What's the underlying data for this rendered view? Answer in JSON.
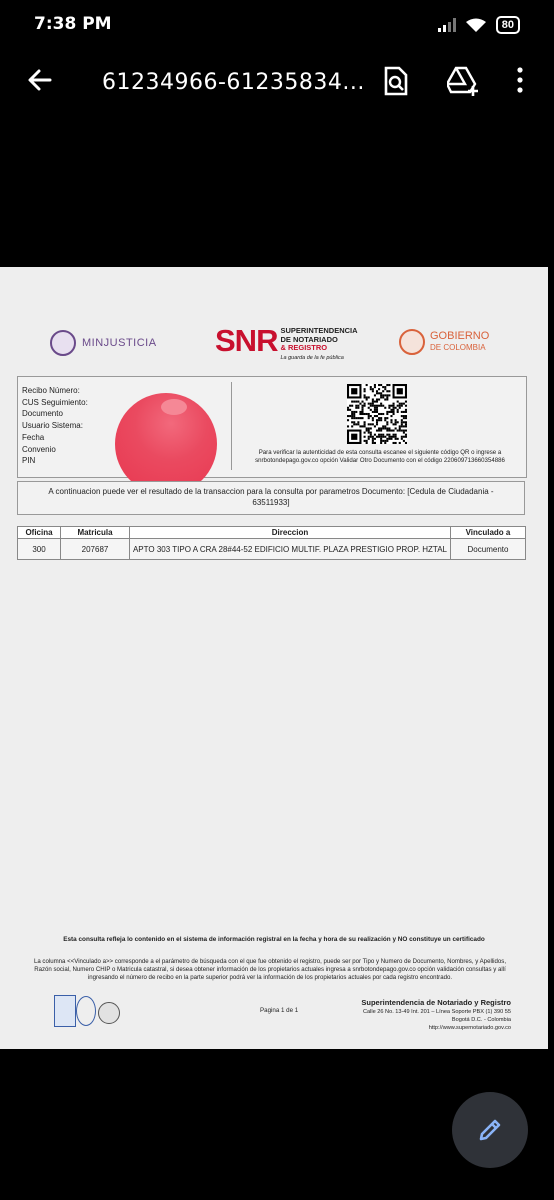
{
  "status_bar": {
    "time": "7:38 PM",
    "battery": "80"
  },
  "app_bar": {
    "title": "61234966-61235834...",
    "icons": [
      "back-arrow-icon",
      "search-document-icon",
      "drive-add-icon",
      "more-vert-icon"
    ]
  },
  "doc": {
    "logos": {
      "minjusticia": "MINJUSTICIA",
      "snr_big": "SNR",
      "snr_line1": "SUPERINTENDENCIA",
      "snr_line2": "DE NOTARIADO",
      "snr_line3": "& REGISTRO",
      "snr_tagline": "La guarda de la fe pública",
      "gobierno_line1": "GOBIERNO",
      "gobierno_line2": "DE COLOMBIA"
    },
    "info": {
      "labels": [
        "Recibo Número:",
        "CUS Seguimiento:",
        "Documento",
        "Usuario Sistema:",
        "Fecha",
        "Convenio",
        "PIN"
      ],
      "verify_text": "Para verificar la autenticidad de esta consulta escanee el siguiente código QR o ingrese a snrbotondepago.gov.co opción Validar Otro Documento con el código 220609713660354886"
    },
    "query_text": "A continuacion puede ver el resultado de la transaccion para la consulta por parametros Documento: [Cedula de Ciudadania - 63511933]",
    "table": {
      "headers": [
        "Oficina",
        "Matricula",
        "Direccion",
        "Vinculado a"
      ],
      "rows": [
        [
          "300",
          "207687",
          "APTO 303 TIPO A CRA 28#44-52 EDIFICIO MULTIF. PLAZA PRESTIGIO PROP. HZTAL",
          "Documento"
        ]
      ]
    },
    "footer": {
      "disclaimer": "Esta consulta refleja lo contenido en el sistema de información registral en la fecha y hora de su realización y NO constituye un certificado",
      "note": "La columna <<Vinculado a>> corresponde a el parámetro de búsqueda con el que fue obtenido el registro, puede ser por Tipo y Numero de Documento, Nombres, y Apellidos, Razón social, Numero CHIP o Matricula catastral, si desea obtener información de los propietarios actuales ingresa a snrbotondepago.gov.co opción validación consultas y allí ingresando el número de recibo en la parte superior podrá ver la información de los propietarios actuales por cada registro encontrado.",
      "page": "Pagina 1 de 1",
      "org_name": "Superintendencia de Notariado y Registro",
      "org_address": "Calle 26 No. 13-49 Int. 201 – Línea Soporte PBX (1) 390 55",
      "org_city": "Bogotá D.C. - Colombia",
      "org_url": "http://www.supernotariado.gov.co"
    }
  },
  "fab": {
    "icon": "edit-pencil-icon"
  }
}
